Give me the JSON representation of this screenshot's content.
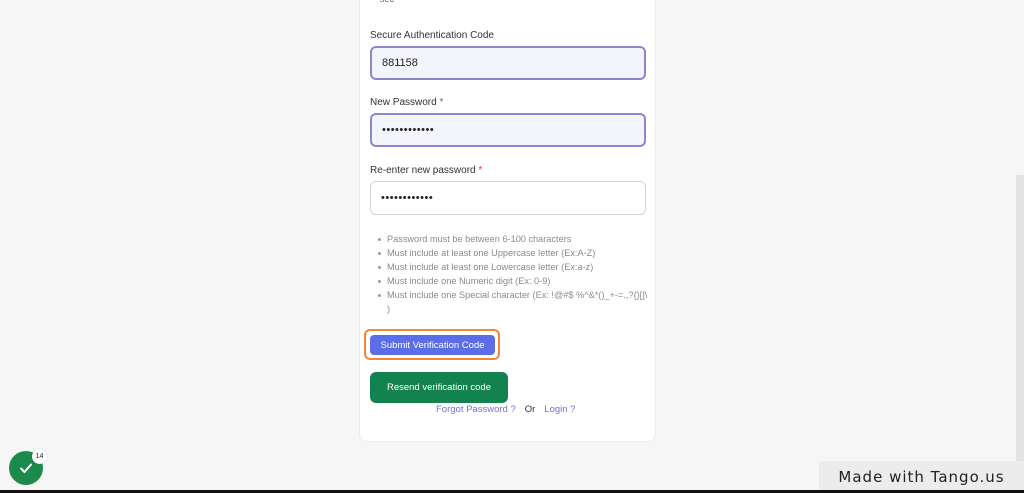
{
  "top_text": "sec",
  "form": {
    "auth_code": {
      "label": "Secure Authentication Code",
      "value": "881158"
    },
    "new_password": {
      "label": "New Password",
      "required_mark": "*",
      "value": "••••••••••••"
    },
    "reenter_password": {
      "label": "Re-enter new password",
      "required_mark": "*",
      "value": "••••••••••••"
    },
    "rules": [
      "Password must be between 6-100 characters",
      "Must include at least one Uppercase letter (Ex:A-Z)",
      "Must include at least one Lowercase letter (Ex:a-z)",
      "Must include one Numeric digit (Ex: 0-9)",
      "Must include one Special character (Ex: !@#$ %^&*()_+-=.,?{}[]\\ )"
    ],
    "submit_label": "Submit Verification Code",
    "resend_label": "Resend verification code",
    "forgot_label": "Forgot Password ?",
    "or_label": "Or",
    "login_label": "Login ?"
  },
  "badge": {
    "count": "14",
    "icon": "checkmark-icon"
  },
  "watermark": "Made with Tango.us",
  "colors": {
    "submit": "#5b6ee8",
    "resend": "#12824f",
    "highlight": "#f0863a",
    "link": "#6b73d9"
  }
}
